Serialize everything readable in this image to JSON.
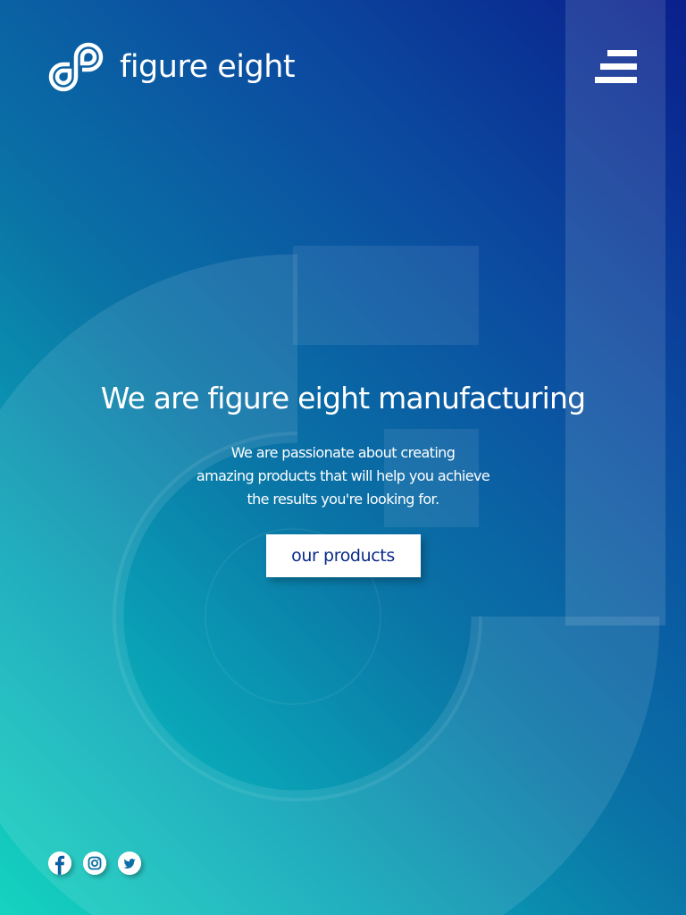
{
  "brand": {
    "name": "figure eight",
    "logo_icon": "figure-eight-logo-icon"
  },
  "header": {
    "menu_icon": "hamburger-menu-icon"
  },
  "hero": {
    "title": "We are figure eight manufacturing",
    "description_lines": [
      "We are passionate about creating",
      "amazing products that will help you achieve",
      "the results you're looking for."
    ],
    "cta_label": "our products"
  },
  "social": {
    "items": [
      {
        "network": "Facebook",
        "icon": "facebook-icon"
      },
      {
        "network": "Instagram",
        "icon": "instagram-icon"
      },
      {
        "network": "Twitter",
        "icon": "twitter-icon"
      }
    ]
  },
  "colors": {
    "gradient_top_right": "#0a1f8c",
    "gradient_bottom_left": "#16d3bf",
    "cta_text": "#0b2a8a",
    "white": "#ffffff"
  }
}
